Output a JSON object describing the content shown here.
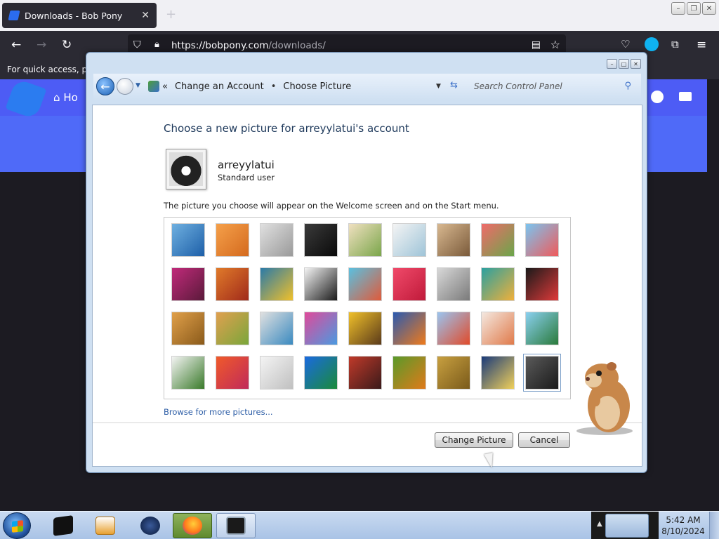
{
  "browser": {
    "tab_title": "Downloads - Bob Pony",
    "new_tab": "+",
    "close_tab": "✕",
    "url_host": "https://bobpony.com",
    "url_path": "/downloads/",
    "bookmarks_text": "For quick access, plac"
  },
  "site": {
    "home_label": "Ho"
  },
  "dialog": {
    "breadcrumb": [
      "Change an Account",
      "Choose Picture"
    ],
    "breadcrumb_sep": "•",
    "search_placeholder": "Search Control Panel",
    "heading": "Choose a new picture for arreyylatui's account",
    "user": {
      "name": "arreyylatui",
      "type": "Standard user"
    },
    "info": "The picture you choose will appear on the Welcome screen and on the Start menu.",
    "browse_link": "Browse for more pictures...",
    "change_button": "Change Picture",
    "cancel_button": "Cancel",
    "selected_index": 35,
    "pictures": [
      {
        "name": "roller-coaster-picture",
        "colors": [
          "#6fb0e0",
          "#1d5fa8"
        ]
      },
      {
        "name": "starfish-picture",
        "colors": [
          "#f5a04a",
          "#d46a1e"
        ]
      },
      {
        "name": "robot-dog-picture",
        "colors": [
          "#e0e0e0",
          "#9a9a9a"
        ]
      },
      {
        "name": "turntable-picture",
        "colors": [
          "#3a3a3a",
          "#0a0a0a"
        ]
      },
      {
        "name": "lucky-cat-picture",
        "colors": [
          "#f0e0c0",
          "#7aa64a"
        ]
      },
      {
        "name": "gyroscope-picture",
        "colors": [
          "#f4f4f4",
          "#9ec4d8"
        ]
      },
      {
        "name": "kitten-picture",
        "colors": [
          "#d8b890",
          "#7a5a3a"
        ]
      },
      {
        "name": "flower-picture",
        "colors": [
          "#f06a6a",
          "#6aa64a"
        ]
      },
      {
        "name": "pinwheel-picture",
        "colors": [
          "#7ac4f0",
          "#f05a5a"
        ]
      },
      {
        "name": "ball-picture",
        "colors": [
          "#c02a7a",
          "#5a1a3a"
        ]
      },
      {
        "name": "fabric-stripes-picture",
        "colors": [
          "#e07a2a",
          "#a02a1a"
        ]
      },
      {
        "name": "leaf-picture",
        "colors": [
          "#2a7aa8",
          "#f0c02a"
        ]
      },
      {
        "name": "border-collie-picture",
        "colors": [
          "#f4f4f4",
          "#1a1a1a"
        ]
      },
      {
        "name": "crayons-picture",
        "colors": [
          "#5ac0e0",
          "#e05a3a"
        ]
      },
      {
        "name": "star-picture",
        "colors": [
          "#f04a6a",
          "#c01a3a"
        ]
      },
      {
        "name": "jacks-picture",
        "colors": [
          "#d8d8d8",
          "#7a7a7a"
        ]
      },
      {
        "name": "stairs-picture",
        "colors": [
          "#2aa0a0",
          "#f0b03a"
        ]
      },
      {
        "name": "origami-crane-picture",
        "colors": [
          "#1a1a1a",
          "#e03a3a"
        ]
      },
      {
        "name": "guitar-picture",
        "colors": [
          "#e0a04a",
          "#8a5a1a"
        ]
      },
      {
        "name": "puppy-picture",
        "colors": [
          "#e0a050",
          "#7aa63a"
        ]
      },
      {
        "name": "toy-robot-picture",
        "colors": [
          "#e0e0e0",
          "#3a8ac0"
        ]
      },
      {
        "name": "colorful-fabric-picture",
        "colors": [
          "#e04a9a",
          "#4a9ae0"
        ]
      },
      {
        "name": "sunflower-picture",
        "colors": [
          "#f0c02a",
          "#5a3a1a"
        ]
      },
      {
        "name": "goldfish-picture",
        "colors": [
          "#2a5ab0",
          "#f07a1a"
        ]
      },
      {
        "name": "hot-air-balloon-picture",
        "colors": [
          "#9ac4f0",
          "#e04a2a"
        ]
      },
      {
        "name": "daruma-doll-picture",
        "colors": [
          "#f4e8e0",
          "#e07a4a"
        ]
      },
      {
        "name": "sailboat-picture",
        "colors": [
          "#8ad0f0",
          "#2a7a3a"
        ]
      },
      {
        "name": "soccer-ball-picture",
        "colors": [
          "#f4f4f4",
          "#3a7a2a"
        ]
      },
      {
        "name": "woven-fabric-picture",
        "colors": [
          "#f05a2a",
          "#c02a5a"
        ]
      },
      {
        "name": "marbles-picture",
        "colors": [
          "#f4f4f4",
          "#c0c0c0"
        ]
      },
      {
        "name": "green-window-picture",
        "colors": [
          "#1a6ae0",
          "#1a8a3a"
        ]
      },
      {
        "name": "rug-pattern-picture",
        "colors": [
          "#c03a2a",
          "#3a1a1a"
        ]
      },
      {
        "name": "butterfly-picture",
        "colors": [
          "#5a9a2a",
          "#e07a1a"
        ]
      },
      {
        "name": "basket-weave-picture",
        "colors": [
          "#c8a040",
          "#7a5a1a"
        ]
      },
      {
        "name": "lighthouse-picture",
        "colors": [
          "#1a3a7a",
          "#f0d05a"
        ]
      },
      {
        "name": "frame-picture",
        "colors": [
          "#5a5a5a",
          "#1a1a1a"
        ]
      }
    ]
  },
  "taskbar": {
    "time": "5:42 AM",
    "date": "8/10/2024"
  }
}
